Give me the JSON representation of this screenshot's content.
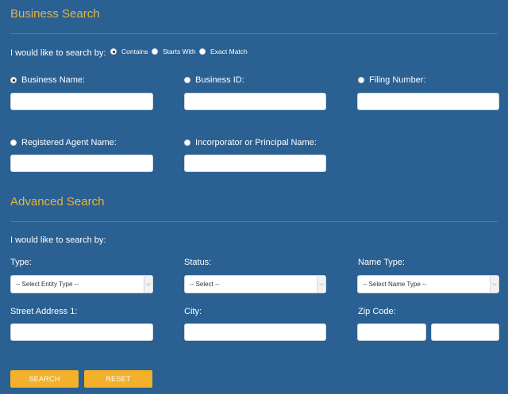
{
  "business_search": {
    "title": "Business Search",
    "search_by_label": "I would like to search by:",
    "match_options": [
      {
        "label": "Contains",
        "checked": true
      },
      {
        "label": "Starts With",
        "checked": false
      },
      {
        "label": "Exact Match",
        "checked": false
      }
    ],
    "fields": [
      {
        "label": "Business Name:",
        "checked": true,
        "value": ""
      },
      {
        "label": "Business ID:",
        "checked": false,
        "value": ""
      },
      {
        "label": "Filing Number:",
        "checked": false,
        "value": ""
      },
      {
        "label": "Registered Agent Name:",
        "checked": false,
        "value": ""
      },
      {
        "label": "Incorporator or Principal Name:",
        "checked": false,
        "value": ""
      }
    ]
  },
  "advanced_search": {
    "title": "Advanced Search",
    "search_by_label": "I would like to search by:",
    "type": {
      "label": "Type:",
      "selected": "-- Select Entity Type --"
    },
    "status": {
      "label": "Status:",
      "selected": "-- Select --"
    },
    "name_type": {
      "label": "Name Type:",
      "selected": "-- Select Name Type --"
    },
    "street": {
      "label": "Street Address 1:",
      "value": ""
    },
    "city": {
      "label": "City:",
      "value": ""
    },
    "zip": {
      "label": "Zip Code:",
      "value": "",
      "ext_value": ""
    }
  },
  "buttons": {
    "search": "SEARCH",
    "reset": "RESET"
  },
  "colors": {
    "background": "#2a6092",
    "accent": "#e9b43c",
    "button": "#f2b02b"
  }
}
